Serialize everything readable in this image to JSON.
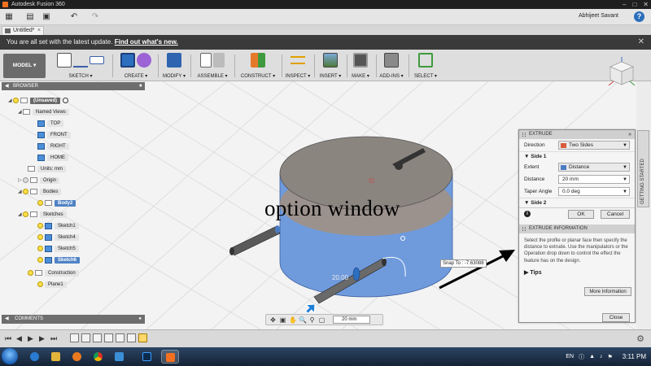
{
  "app": {
    "title": "Autodesk Fusion 360",
    "user": "Abhijeet Savant",
    "help": "?",
    "doc_tab": "Untitled*"
  },
  "banner": {
    "text": "You are all set with the latest update.",
    "link": "Find out what's new.",
    "close": "✕"
  },
  "toolbar": {
    "workspace": "MODEL ▾",
    "groups": [
      {
        "label": "SKETCH ▾"
      },
      {
        "label": "CREATE ▾"
      },
      {
        "label": "MODIFY ▾"
      },
      {
        "label": "ASSEMBLE ▾"
      },
      {
        "label": "CONSTRUCT ▾"
      },
      {
        "label": "INSPECT ▾"
      },
      {
        "label": "INSERT ▾"
      },
      {
        "label": "MAKE ▾"
      },
      {
        "label": "ADD-INS ▾"
      },
      {
        "label": "SELECT ▾"
      }
    ],
    "accent": "#2c6fbf"
  },
  "browser": {
    "title": "BROWSER",
    "root": "(Unsaved)",
    "named_views": "Named Views",
    "views": [
      "TOP",
      "FRONT",
      "RIGHT",
      "HOME"
    ],
    "units": "Units: mm",
    "origin": "Origin",
    "bodies": "Bodies",
    "body2": "Body2",
    "sketches": "Sketches",
    "sketch_items": [
      "Sketch1",
      "Sketch4",
      "Sketch5",
      "Sketch6"
    ],
    "construction": "Construction",
    "plane1": "Plane1"
  },
  "comments": {
    "title": "COMMENTS"
  },
  "navbar": {
    "units_value": "20 mm"
  },
  "viewport": {
    "annotation": "option window",
    "snap_text": "Snap To : -7.63088",
    "dim_value": "20.00",
    "body_color": "#6f9bdd",
    "top_color": "#8b8580"
  },
  "side_tab": {
    "label": "GETTING STARTED"
  },
  "extrude": {
    "title": "EXTRUDE",
    "direction_label": "Direction",
    "direction_value": "Two Sides",
    "side1": "Side 1",
    "extent_label": "Extent",
    "extent_value": "Distance",
    "distance_label": "Distance",
    "distance_value": "20 mm",
    "taper_label": "Taper Angle",
    "taper_value": "0.0 deg",
    "side2": "Side 2",
    "ok": "OK",
    "cancel": "Cancel",
    "info_title": "EXTRUDE INFORMATION",
    "info_text": "Select the profile or planar face then specify the distance to extrude. Use the manipulators or the Operation drop down to control the effect the feature has on the design.",
    "tips": "Tips",
    "more_info": "More Information",
    "close": "Close"
  },
  "taskbar": {
    "lang": "EN",
    "time": "3:11 PM"
  }
}
